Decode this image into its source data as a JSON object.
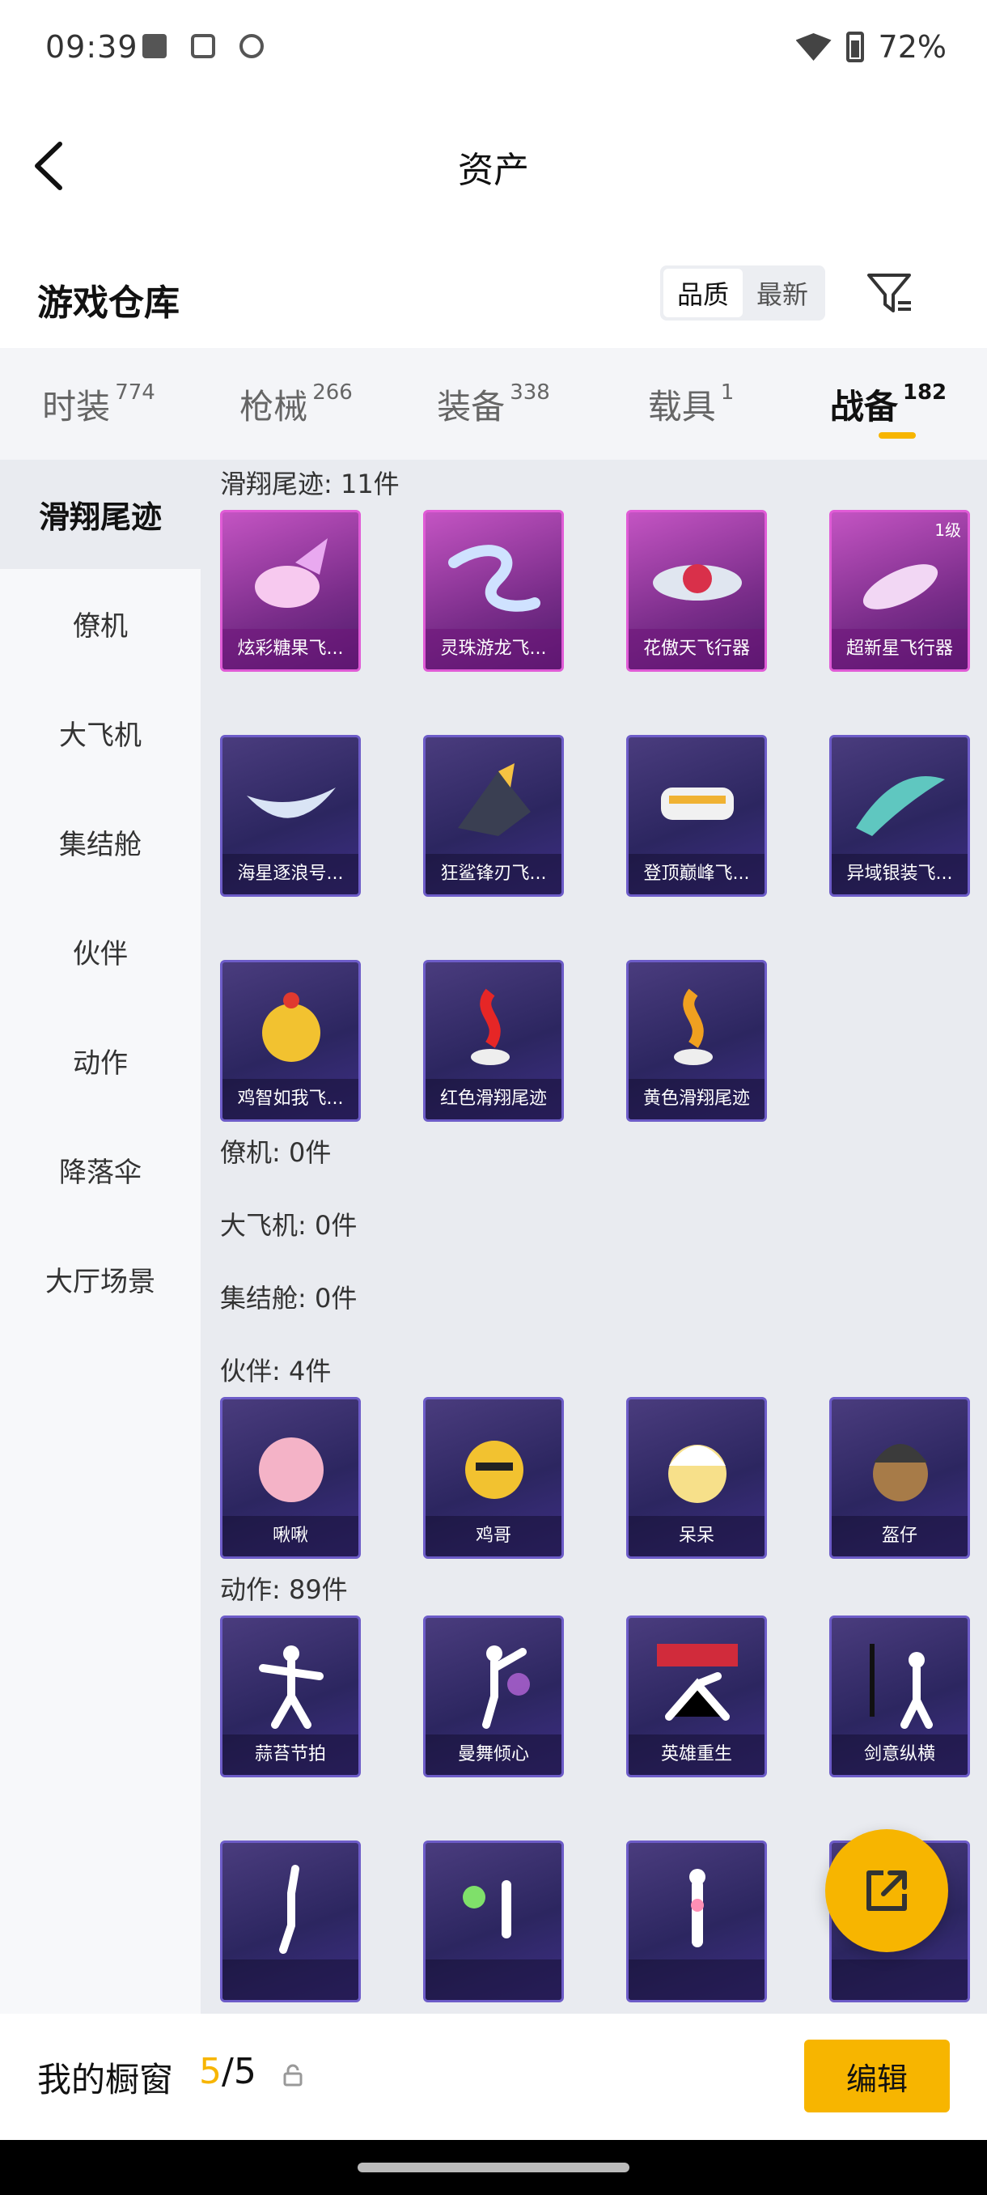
{
  "status": {
    "time": "09:39",
    "battery": "72%"
  },
  "header": {
    "title": "资产"
  },
  "warehouse": {
    "label": "游戏仓库",
    "sort_quality": "品质",
    "sort_newest": "最新"
  },
  "categories": [
    {
      "name": "时装",
      "count": "774"
    },
    {
      "name": "枪械",
      "count": "266"
    },
    {
      "name": "装备",
      "count": "338"
    },
    {
      "name": "载具",
      "count": "1"
    },
    {
      "name": "战备",
      "count": "182"
    }
  ],
  "sidebar": [
    "滑翔尾迹",
    "僚机",
    "大飞机",
    "集结舱",
    "伙伴",
    "动作",
    "降落伞",
    "大厅场景"
  ],
  "sections": {
    "trail": {
      "title": "滑翔尾迹: 11件",
      "items": [
        "炫彩糖果飞...",
        "灵珠游龙飞...",
        "花傲天飞行器",
        "超新星飞行器",
        "海星逐浪号...",
        "狂鲨锋刃飞...",
        "登顶巅峰飞...",
        "异域银装飞...",
        "鸡智如我飞...",
        "红色滑翔尾迹",
        "黄色滑翔尾迹"
      ],
      "level_badge": "1级"
    },
    "wingman": {
      "title": "僚机: 0件"
    },
    "plane": {
      "title": "大飞机: 0件"
    },
    "pod": {
      "title": "集结舱: 0件"
    },
    "partner": {
      "title": "伙伴: 4件",
      "items": [
        "啾啾",
        "鸡哥",
        "呆呆",
        "盔仔"
      ]
    },
    "emote": {
      "title": "动作: 89件",
      "items": [
        "蒜苔节拍",
        "曼舞倾心",
        "英雄重生",
        "剑意纵横",
        "",
        "",
        "",
        ""
      ]
    }
  },
  "bottom": {
    "label": "我的橱窗",
    "used": "5",
    "sep_total": "/5",
    "edit": "编辑"
  },
  "colors": {
    "accent": "#f7b500",
    "card_purple": "#c454c3",
    "card_blue": "#3e2f86"
  }
}
